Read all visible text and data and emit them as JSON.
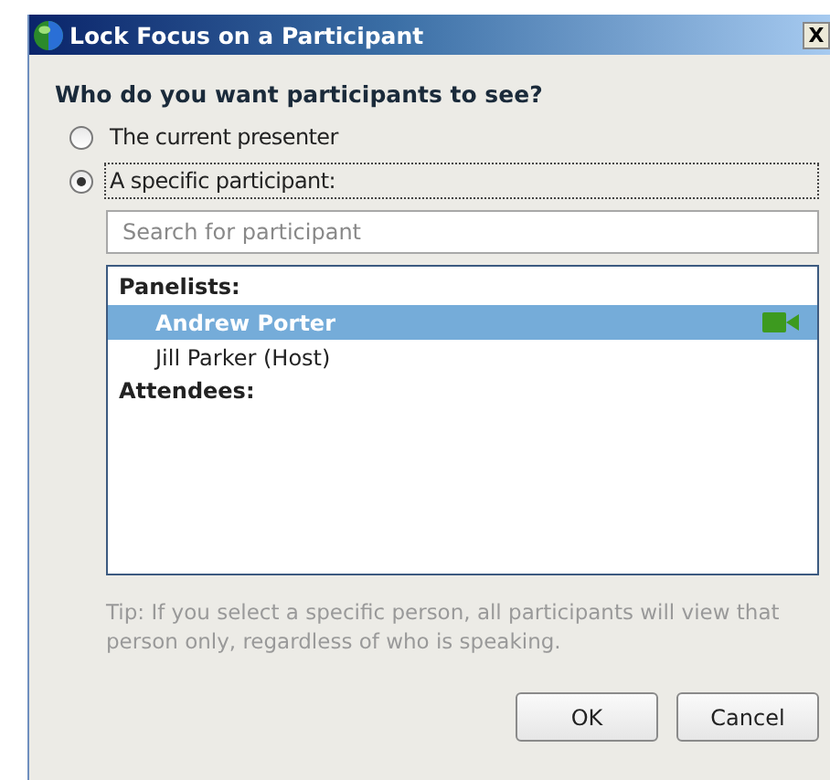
{
  "window": {
    "title": "Lock Focus on a Participant",
    "close": "X"
  },
  "heading": "Who do you want participants to see?",
  "options": [
    {
      "label": "The current presenter",
      "selected": false
    },
    {
      "label": "A specific participant:",
      "selected": true
    }
  ],
  "search": {
    "placeholder": "Search for participant"
  },
  "groups": [
    {
      "label": "Panelists:",
      "members": [
        {
          "name": "Andrew Porter",
          "selected": true,
          "video": true
        },
        {
          "name": "Jill Parker (Host)",
          "selected": false,
          "video": false
        }
      ]
    },
    {
      "label": "Attendees:"
    }
  ],
  "tip": "Tip: If you select a specific person, all participants will view that person only, regardless of who is speaking.",
  "buttons": [
    "OK",
    "Cancel"
  ]
}
